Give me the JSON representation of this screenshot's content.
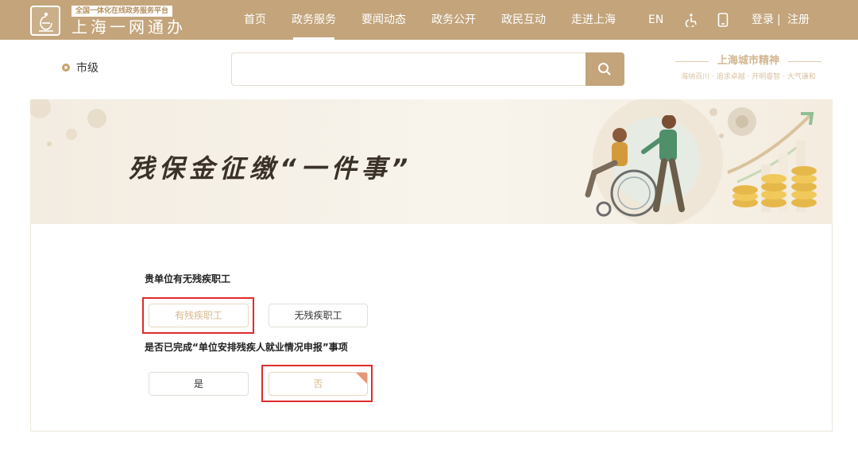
{
  "header": {
    "logo_tag": "全国一体化在线政务服务平台",
    "logo_name": "上海一网通办",
    "nav": [
      "首页",
      "政务服务",
      "要闻动态",
      "政务公开",
      "政民互动",
      "走进上海"
    ],
    "active_nav": "政务服务",
    "lang": "EN",
    "login": "登录",
    "separator": "|",
    "register": "注册",
    "icons": [
      "accessibility-icon",
      "mobile-icon"
    ],
    "bg_color": "#c3a47b"
  },
  "location": {
    "label": "市级"
  },
  "search": {
    "placeholder": ""
  },
  "slogan": {
    "title": "上海城市精神",
    "subtitle": "海纳百川 · 追求卓越 · 开明睿智 · 大气谦和"
  },
  "banner": {
    "title": "残保金征缴“一件事”"
  },
  "form": {
    "q1": {
      "label": "贵单位有无残疾职工",
      "options": [
        "有残疾职工",
        "无残疾职工"
      ],
      "selected": "有残疾职工"
    },
    "q2": {
      "label": "是否已完成“单位安排残疾人就业情况申报”事项",
      "options": [
        "是",
        "否"
      ],
      "selected": "否"
    }
  },
  "colors": {
    "accent": "#c3a47b",
    "highlight": "#e02b2b",
    "selected_text": "#d6b98d"
  }
}
